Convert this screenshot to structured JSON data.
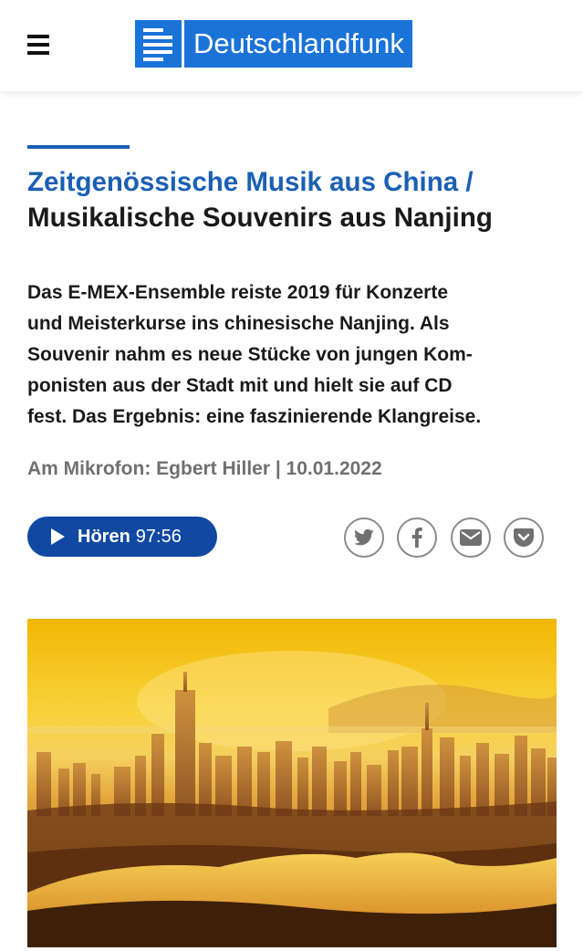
{
  "header": {
    "logo_text": "Deutschlandfunk",
    "menu_icon": "hamburger-menu-icon",
    "brand_color": "#1a73d6"
  },
  "article": {
    "kicker": "Zeitgenössische Musik aus China /",
    "title": "Musikalische Souvenirs aus Nanjing",
    "teaser_lines": [
      "Das E-MEX-Ensemble reiste 2019 für Konzerte",
      "und Meisterkurse ins chinesische Nanjing. Als",
      "Souvenir nahm es neue Stücke von jungen Kom-",
      "ponisten aus der Stadt mit und hielt sie auf CD",
      "fest. Das Ergebnis: eine faszinierende Klangreise."
    ],
    "meta": "Am Mikrofon: Egbert Hiller | 10.01.2022",
    "accent_color": "#1a5fb4"
  },
  "player": {
    "label": "Hören",
    "duration": "97:56",
    "icon": "play-icon",
    "button_color": "#1048a2"
  },
  "share": {
    "icons": [
      "twitter-icon",
      "facebook-icon",
      "mail-icon",
      "pocket-icon"
    ]
  },
  "hero_image": {
    "subject": "skyline-photo"
  }
}
